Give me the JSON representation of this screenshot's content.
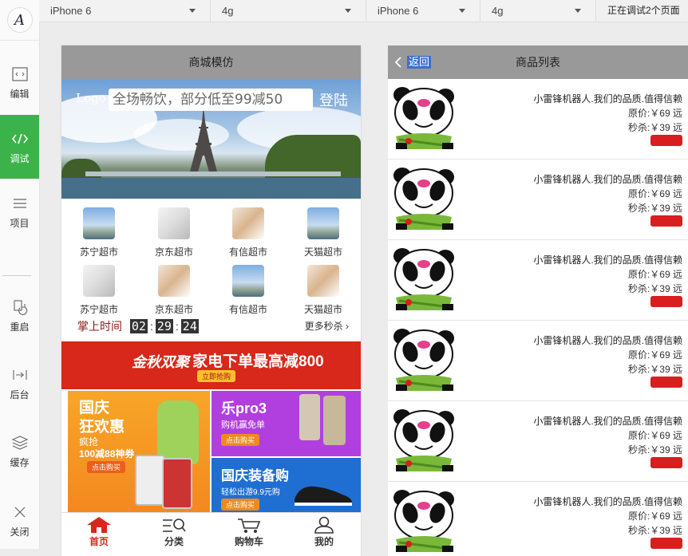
{
  "toolbar": {
    "device1": "iPhone 6",
    "network1": "4g",
    "device2": "iPhone 6",
    "network2": "4g",
    "status": "正在调试2个页面"
  },
  "sidebar": {
    "logo": "A",
    "items": [
      {
        "label": "编辑",
        "icon": "code-window-icon"
      },
      {
        "label": "调试",
        "icon": "code-brackets-icon",
        "active": true
      },
      {
        "label": "项目",
        "icon": "menu-lines-icon"
      },
      {
        "label": "重启",
        "icon": "restart-icon"
      },
      {
        "label": "后台",
        "icon": "background-icon"
      },
      {
        "label": "缓存",
        "icon": "layers-icon"
      },
      {
        "label": "关闭",
        "icon": "close-icon"
      }
    ],
    "active_color": "#3cb34a"
  },
  "phone1": {
    "nav_title": "商城模仿",
    "banner": {
      "logo": "Logo",
      "search_placeholder": "全场畅饮，部分低至99减50",
      "login": "登陆"
    },
    "grid": [
      {
        "label": "苏宁超市",
        "thumb": "t1"
      },
      {
        "label": "京东超市",
        "thumb": "t2"
      },
      {
        "label": "有信超市",
        "thumb": "t3"
      },
      {
        "label": "天猫超市",
        "thumb": "t1"
      },
      {
        "label": "苏宁超市",
        "thumb": "t2"
      },
      {
        "label": "京东超市",
        "thumb": "t3"
      },
      {
        "label": "有信超市",
        "thumb": "t1"
      },
      {
        "label": "天猫超市",
        "thumb": "t3"
      }
    ],
    "flash_sale": {
      "label": "掌上时间",
      "hours": "02",
      "minutes": "29",
      "seconds": "24",
      "more": "更多秒杀"
    },
    "promo": {
      "brand": "金秋双聚",
      "headline": "家电下单最高减800",
      "headline_btn": "立即抢购",
      "left_title1": "国庆",
      "left_title2": "狂欢惠",
      "left_sub": "疯抢",
      "left_deal": "100减88神券",
      "left_btn": "点击购买",
      "rt_title": "乐pro3",
      "rt_sub": "购机赢免单",
      "rt_btn": "点击购买",
      "rb_title": "国庆装备购",
      "rb_sub": "轻松出游9.9元购",
      "rb_btn": "点击购买"
    },
    "tabs": [
      {
        "label": "首页",
        "icon": "home-icon",
        "active": true
      },
      {
        "label": "分类",
        "icon": "category-icon"
      },
      {
        "label": "购物车",
        "icon": "cart-icon"
      },
      {
        "label": "我的",
        "icon": "user-icon"
      }
    ],
    "accent": "#d8271b"
  },
  "phone2": {
    "back_label": "返回",
    "nav_title": "商品列表",
    "products": [
      {
        "title": "小雷锋机器人.我们的品质.值得信赖",
        "original": "原价:￥69 远",
        "sale": "秒杀:￥39 远"
      },
      {
        "title": "小雷锋机器人.我们的品质.值得信赖",
        "original": "原价:￥69 远",
        "sale": "秒杀:￥39 远"
      },
      {
        "title": "小雷锋机器人.我们的品质.值得信赖",
        "original": "原价:￥69 远",
        "sale": "秒杀:￥39 远"
      },
      {
        "title": "小雷锋机器人.我们的品质.值得信赖",
        "original": "原价:￥69 远",
        "sale": "秒杀:￥39 远"
      },
      {
        "title": "小雷锋机器人.我们的品质.值得信赖",
        "original": "原价:￥69 远",
        "sale": "秒杀:￥39 远"
      },
      {
        "title": "小雷锋机器人.我们的品质.值得信赖",
        "original": "原价:￥69 远",
        "sale": "秒杀:￥39 远"
      }
    ],
    "buy_color": "#d81e1e"
  }
}
